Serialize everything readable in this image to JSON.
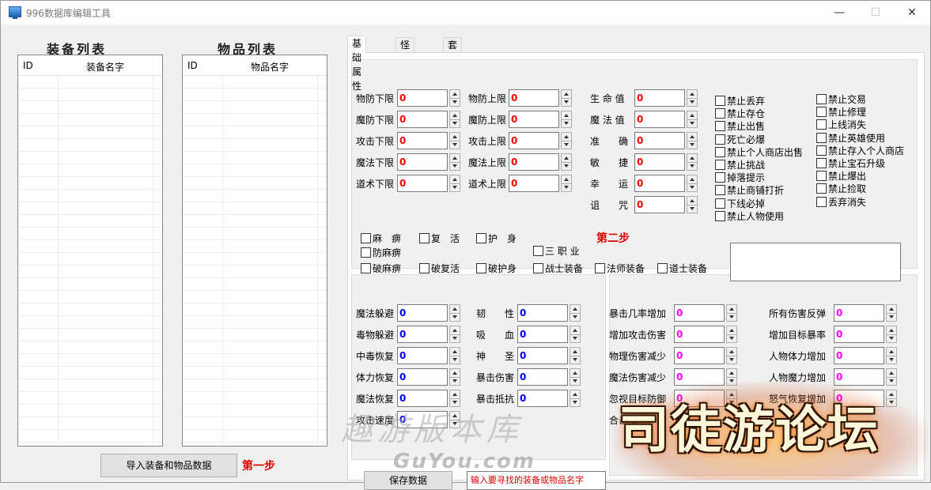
{
  "window": {
    "title": "996数据库编辑工具",
    "minimize": "—",
    "maximize": "☐",
    "close": "✕",
    "app_icon": "monitor-icon"
  },
  "equip_list": {
    "title": "装备列表",
    "col_id": "ID",
    "col_name": "装备名字"
  },
  "item_list": {
    "title": "物品列表",
    "col_id": "ID",
    "col_name": "物品名字"
  },
  "import_button": "导入装备和物品数据",
  "step1": "第一步",
  "step2": "第二步",
  "tabs": [
    "基础属性",
    "怪物属性",
    "套装属性"
  ],
  "basic": {
    "col1": [
      {
        "label": "物防下限",
        "value": "0"
      },
      {
        "label": "魔防下限",
        "value": "0"
      },
      {
        "label": "攻击下限",
        "value": "0"
      },
      {
        "label": "魔法下限",
        "value": "0"
      },
      {
        "label": "道术下限",
        "value": "0"
      }
    ],
    "col2": [
      {
        "label": "物防上限",
        "value": "0"
      },
      {
        "label": "魔防上限",
        "value": "0"
      },
      {
        "label": "攻击上限",
        "value": "0"
      },
      {
        "label": "魔法上限",
        "value": "0"
      },
      {
        "label": "道术上限",
        "value": "0"
      }
    ],
    "col3": [
      {
        "label": "生 命 值",
        "value": "0"
      },
      {
        "label": "魔 法 值",
        "value": "0"
      },
      {
        "label": "准　　确",
        "value": "0"
      },
      {
        "label": "敏　　捷",
        "value": "0"
      },
      {
        "label": "幸　　运",
        "value": "0"
      },
      {
        "label": "诅　　咒",
        "value": "0"
      }
    ]
  },
  "flags_left": [
    "禁止丢弃",
    "禁止存仓",
    "禁止出售",
    "死亡必爆",
    "禁止个人商店出售",
    "禁止挑战",
    "掉落提示",
    "禁止商铺打折",
    "下线必掉",
    "禁止人物使用"
  ],
  "flags_right": [
    "禁止交易",
    "禁止修理",
    "上线消失",
    "禁止英雄使用",
    "禁止存入个人商店",
    "禁止宝石升级",
    "禁止爆出",
    "禁止捡取",
    "丢弃消失"
  ],
  "effects_row1": [
    "麻　痹",
    "复　活",
    "护　身"
  ],
  "effects_row2": [
    "防麻痹",
    "三 职 业"
  ],
  "effects_row3": [
    "破麻痹",
    "破复活",
    "破护身",
    "战士装备",
    "法师装备",
    "道士装备"
  ],
  "stats_a": [
    {
      "label": "魔法躲避",
      "value": "0"
    },
    {
      "label": "毒物躲避",
      "value": "0"
    },
    {
      "label": "中毒恢复",
      "value": "0"
    },
    {
      "label": "体力恢复",
      "value": "0"
    },
    {
      "label": "魔法恢复",
      "value": "0"
    },
    {
      "label": "攻击速度",
      "value": "0"
    }
  ],
  "stats_b": [
    {
      "label": "韧　　性",
      "value": "0"
    },
    {
      "label": "吸　　血",
      "value": "0"
    },
    {
      "label": "神　　圣",
      "value": "0"
    },
    {
      "label": "暴击伤害",
      "value": "0"
    },
    {
      "label": "暴击抵抗",
      "value": "0"
    }
  ],
  "stats_c": [
    {
      "label": "暴击几率增加",
      "value": "0"
    },
    {
      "label": "增加攻击伤害",
      "value": "0"
    },
    {
      "label": "物理伤害减少",
      "value": "0"
    },
    {
      "label": "魔法伤害减少",
      "value": "0"
    },
    {
      "label": "忽视目标防御",
      "value": "0"
    },
    {
      "label": "合击攻",
      "value": ""
    }
  ],
  "stats_d": [
    {
      "label": "所有伤害反弹",
      "value": "0"
    },
    {
      "label": "增加目标暴率",
      "value": "0"
    },
    {
      "label": "人物体力增加",
      "value": "0"
    },
    {
      "label": "人物魔力增加",
      "value": "0"
    },
    {
      "label": "怒气恢复增加",
      "value": "0"
    }
  ],
  "save_button": "保存数据",
  "search_placeholder": "输入要寻找的装备或物品名字",
  "watermark1": "趣游版本库",
  "watermark2": "GuYou.com",
  "watermark3": "司徒游论坛"
}
